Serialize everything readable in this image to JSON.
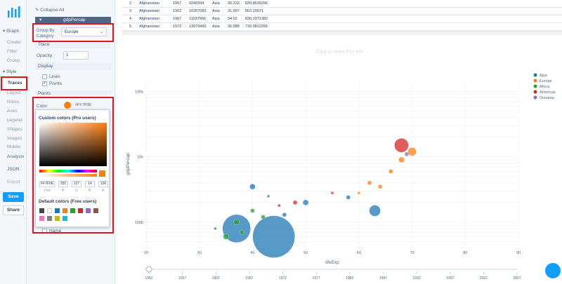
{
  "nav": {
    "graph": "Graph",
    "graph_items": [
      "Create",
      "Filter",
      "Group"
    ],
    "style": "Style",
    "style_items": [
      "Layout",
      "Notes",
      "Axes",
      "Legend",
      "Shapes",
      "Images",
      "Mobile"
    ],
    "active": "Traces",
    "analysis": "Analysis",
    "json": "JSON",
    "export": "Export",
    "save": "Save",
    "share": "Share"
  },
  "panel": {
    "collapse_all": "Collapse All",
    "trace_name": "gdpPercap",
    "group_by_label": "Group By Category",
    "group_by_value": "Europe",
    "trace_section": "Trace",
    "opacity_label": "Opacity",
    "opacity_value": "1",
    "display_section": "Display",
    "lines_label": "Lines",
    "points_label": "Points",
    "points_section": "Points",
    "color_label": "Color",
    "color_hex": "#FF7F0E",
    "name_label": "Name"
  },
  "picker": {
    "custom_title": "Custom colors (Pro users)",
    "default_title": "Default colors (Free users)",
    "fields": [
      "FF7F0E",
      "255",
      "127",
      "14",
      "100"
    ],
    "field_labels": [
      "Hex",
      "R",
      "G",
      "B",
      "A"
    ],
    "defaults": [
      "#444444",
      "#ffffff",
      "#1f77b4",
      "#ff7f0e",
      "#2ca02c",
      "#d62728",
      "#9467bd",
      "#8c564b",
      "#e377c2",
      "#7f7f7f",
      "#bcbd22",
      "#17becf"
    ]
  },
  "table": {
    "rows": [
      [
        "2",
        "Afghanistan",
        "1957",
        "9240934",
        "Asia",
        "30.332",
        "820.8530296"
      ],
      [
        "3",
        "Afghanistan",
        "1962",
        "10267083",
        "Asia",
        "31.997",
        "853.10071"
      ],
      [
        "4",
        "Afghanistan",
        "1967",
        "11537966",
        "Asia",
        "34.02",
        "836.1971382"
      ],
      [
        "5",
        "Afghanistan",
        "1972",
        "13079460",
        "Asia",
        "36.088",
        "739.9811058"
      ]
    ]
  },
  "plot_title_placeholder": "Click to enter Plot title",
  "chart_data": {
    "type": "scatter",
    "xlabel": "lifeExp",
    "ylabel": "gdpPercap",
    "x_ticks": [
      "20",
      "30",
      "40",
      "50",
      "60",
      "70",
      "80",
      "90"
    ],
    "y_ticks": [
      "1000",
      "10k",
      "100k"
    ],
    "xlim": [
      20,
      90
    ],
    "y_scale": "log",
    "legend_position": "top-right",
    "colors": {
      "Asia": "#1f77b4",
      "Europe": "#ff7f0e",
      "Africa": "#2ca02c",
      "Americas": "#d62728",
      "Oceania": "#9467bd"
    },
    "series": [
      {
        "name": "Asia",
        "points": [
          [
            37,
            800,
            20
          ],
          [
            44,
            600,
            30
          ],
          [
            63,
            1500,
            8
          ],
          [
            50,
            2000,
            4
          ],
          [
            40,
            3500,
            4
          ],
          [
            46,
            1300,
            3
          ],
          [
            58,
            2400,
            3
          ]
        ]
      },
      {
        "name": "Europe",
        "points": [
          [
            70,
            12000,
            6
          ],
          [
            68,
            9000,
            4
          ],
          [
            66,
            6000,
            3
          ],
          [
            62,
            4000,
            3
          ],
          [
            60,
            2800,
            2
          ],
          [
            64,
            3500,
            3
          ]
        ]
      },
      {
        "name": "Africa",
        "points": [
          [
            35,
            600,
            4
          ],
          [
            37,
            1000,
            4
          ],
          [
            40,
            1500,
            3
          ],
          [
            42,
            1200,
            3
          ],
          [
            43,
            2500,
            2
          ],
          [
            33,
            800,
            2
          ],
          [
            38,
            700,
            3
          ]
        ]
      },
      {
        "name": "Americas",
        "points": [
          [
            68,
            15000,
            10
          ],
          [
            48,
            2000,
            3
          ],
          [
            55,
            2800,
            2
          ],
          [
            45,
            1800,
            2
          ]
        ]
      },
      {
        "name": "Oceania",
        "points": [
          [
            69,
            11000,
            3
          ]
        ]
      }
    ],
    "slider_ticks": [
      "1952",
      "1957",
      "1962",
      "1967",
      "1972",
      "1977",
      "1982",
      "1987",
      "1992",
      "1997",
      "2002",
      "2007"
    ]
  }
}
